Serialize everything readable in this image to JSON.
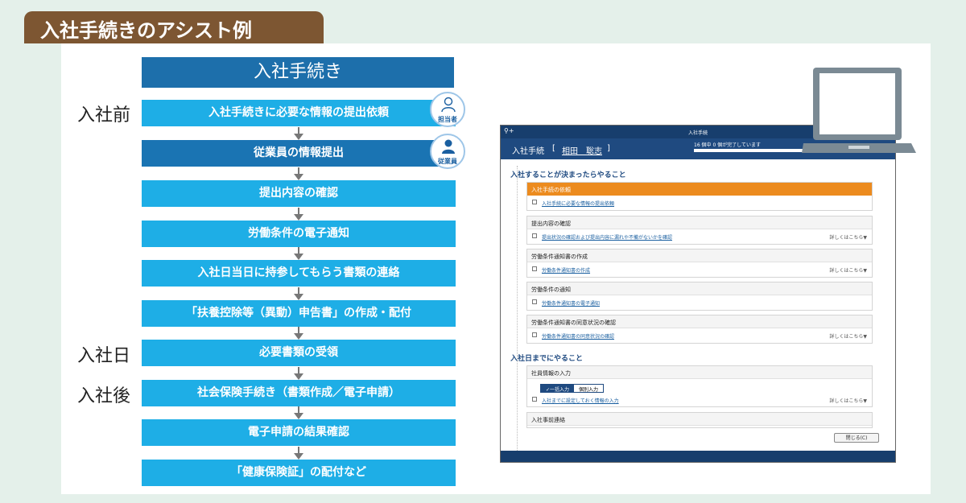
{
  "banner": {
    "title": "入社手続きのアシスト例"
  },
  "flow": {
    "header": "入社手続き",
    "steps": [
      "入社手続きに必要な情報の提出依頼",
      "従業員の情報提出",
      "提出内容の確認",
      "労働条件の電子通知",
      "入社日当日に持参してもらう書類の連絡",
      "「扶養控除等（異動）申告書」の作成・配付",
      "必要書類の受領",
      "社会保険手続き（書類作成／電子申請）",
      "電子申請の結果確認",
      "「健康保険証」の配付など"
    ],
    "stages": [
      "入社前",
      "入社日",
      "入社後"
    ],
    "roles": [
      "担当者",
      "従業員"
    ]
  },
  "colors": {
    "step": "#1eaee6",
    "step_dark": "#1a74b3",
    "header": "#1d6fab",
    "banner": "#7d5632",
    "orange": "#ec8b1e"
  },
  "screen": {
    "window_title": "入社手続",
    "header_title": "入社手続",
    "bracket_open": "[",
    "bracket_close": "]",
    "employee_name": "相田　聡志",
    "progress_text": "16 個中 0 個が完了しています",
    "progress": 0,
    "section1": "入社することが決まったらやること",
    "section2": "入社日までにやること",
    "cards": [
      {
        "title": "入社手続の依頼",
        "item": "入社手続に必要な情報の提出依頼",
        "detail": ""
      },
      {
        "title": "提出内容の確認",
        "item": "提出状況の確認および提出内容に漏れや不備がないかを確認",
        "detail": "詳しくはこちら▼"
      },
      {
        "title": "労働条件通知書の作成",
        "item": "労働条件通知書の作成",
        "detail": "詳しくはこちら▼"
      },
      {
        "title": "労働条件の通知",
        "item": "労働条件通知書の電子通知",
        "detail": ""
      },
      {
        "title": "労働条件通知書の同意状況の確認",
        "item": "労働条件通知書の同意状況の確認",
        "detail": "詳しくはこちら▼"
      },
      {
        "title": "社員情報の入力",
        "item": "入社までに設定しておく情報の入力",
        "detail": "詳しくはこちら▼"
      },
      {
        "title": "入社事前連絡",
        "item": "",
        "detail": ""
      }
    ],
    "seg_on": "✓一括入力",
    "seg_off": "個別入力",
    "close_label": "閉じる(C)"
  }
}
